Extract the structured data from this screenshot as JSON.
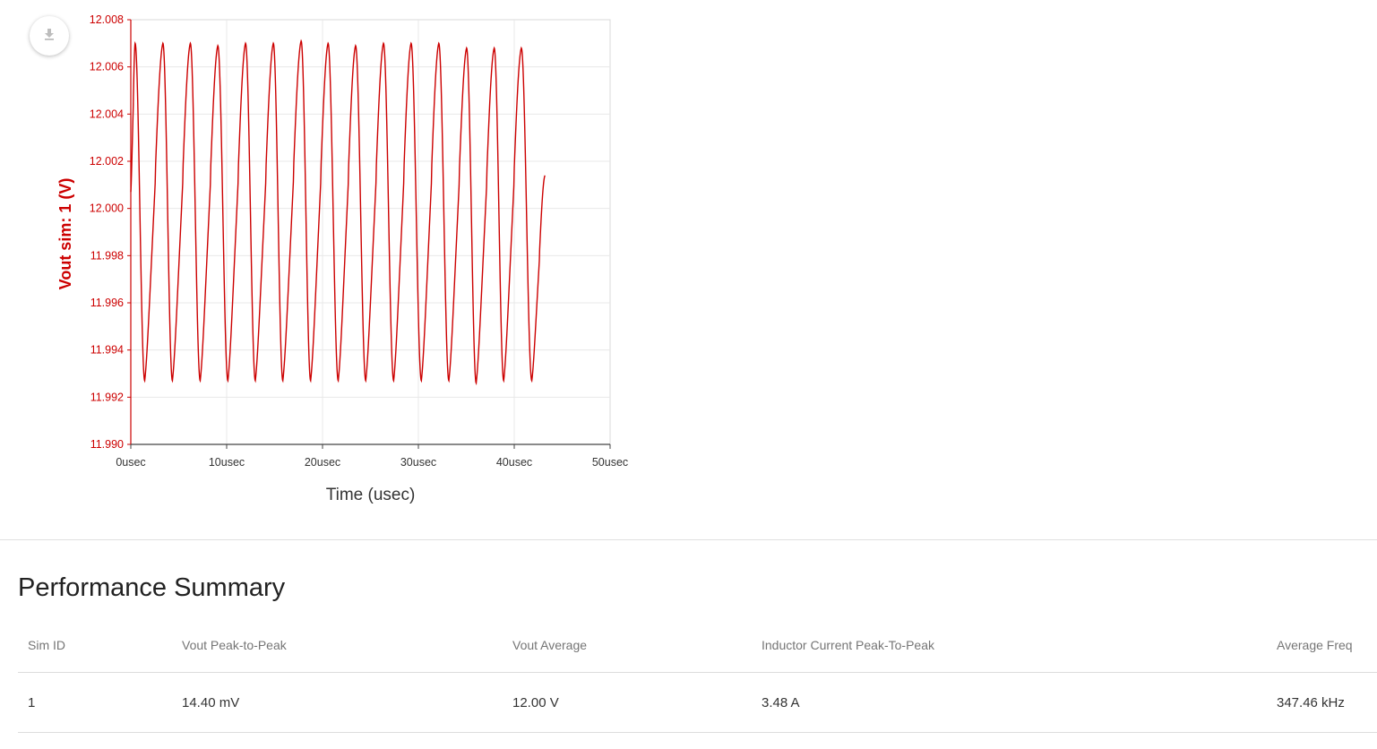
{
  "chart_data": {
    "type": "line",
    "xlabel": "Time (usec)",
    "ylabel": "Vout sim: 1 (V)",
    "xlim": [
      0,
      50
    ],
    "ylim": [
      11.99,
      12.008
    ],
    "x_ticks": [
      "0usec",
      "10usec",
      "20usec",
      "30usec",
      "40usec",
      "50usec"
    ],
    "y_ticks": [
      "11.990",
      "11.992",
      "11.994",
      "11.996",
      "11.998",
      "12.000",
      "12.002",
      "12.004",
      "12.006",
      "12.008"
    ],
    "grid": true,
    "color": "#cc0000",
    "series": [
      {
        "x": [
          0,
          0.45,
          1.45,
          3.35,
          4.34,
          6.21,
          7.24,
          9.08,
          10.13,
          11.97,
          12.99,
          14.87,
          15.86,
          17.77,
          18.76,
          20.58,
          21.64,
          23.45,
          24.51,
          26.36,
          27.42,
          29.24,
          30.31,
          32.13,
          33.18,
          35.03,
          36.03,
          37.91,
          38.9,
          40.74,
          41.83,
          43.2
        ],
        "y": [
          12.0007,
          12.007,
          11.9927,
          12.007,
          11.9927,
          12.007,
          11.9927,
          12.0069,
          11.9927,
          12.007,
          11.9927,
          12.007,
          11.9927,
          12.0071,
          11.9927,
          12.007,
          11.9927,
          12.0069,
          11.9927,
          12.007,
          11.9927,
          12.007,
          11.9927,
          12.007,
          11.9927,
          12.0068,
          11.9926,
          12.0068,
          11.9927,
          12.0068,
          11.9927,
          12.0014
        ]
      }
    ]
  },
  "icons": {
    "download": "download-icon"
  },
  "summary": {
    "title": "Performance Summary",
    "columns": [
      "Sim ID",
      "Vout Peak-to-Peak",
      "Vout Average",
      "Inductor Current Peak-To-Peak",
      "Average Freq"
    ],
    "rows": [
      [
        "1",
        "14.40 mV",
        "12.00 V",
        "3.48 A",
        "347.46 kHz"
      ]
    ]
  }
}
